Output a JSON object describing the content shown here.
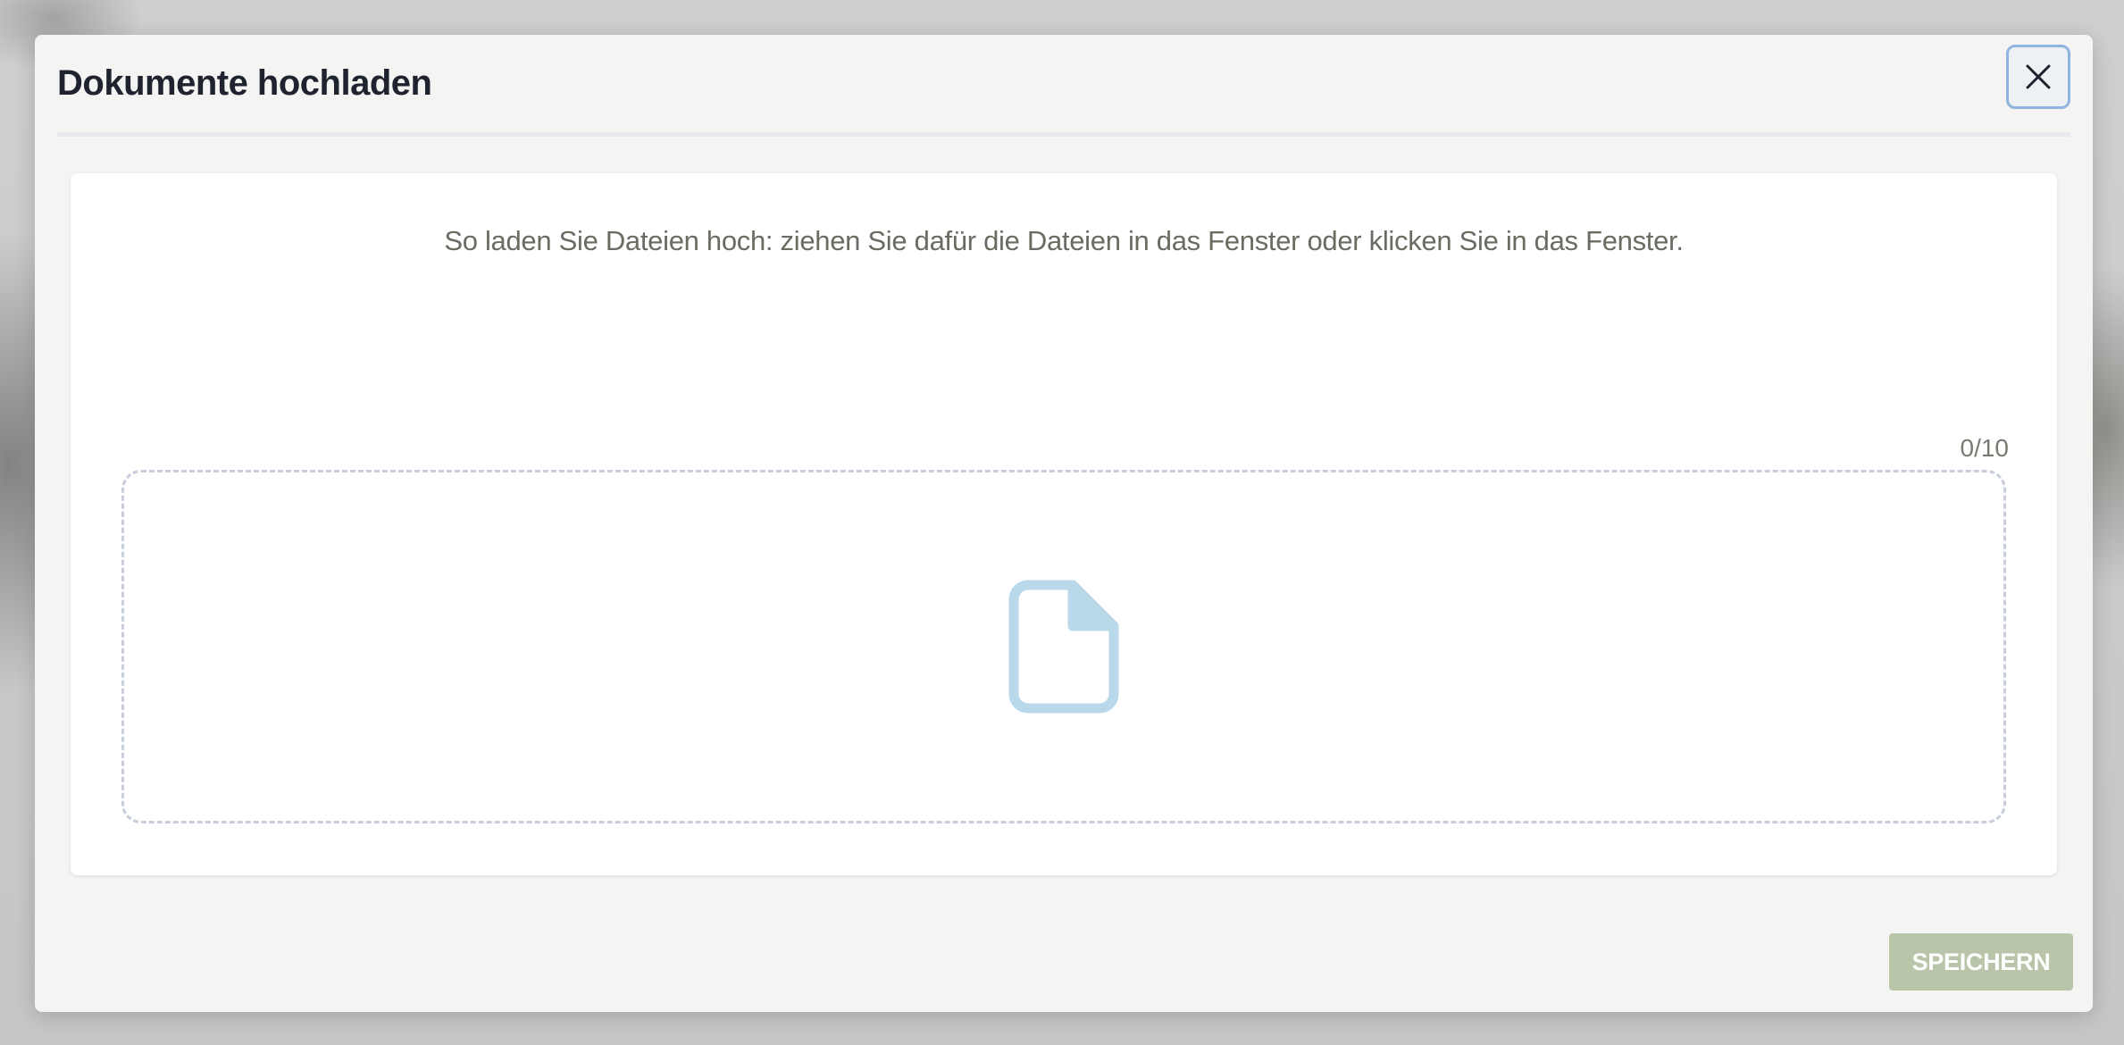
{
  "modal": {
    "title": "Dokumente hochladen",
    "close_icon": "close-icon"
  },
  "upload": {
    "instructions": "So laden Sie Dateien hoch: ziehen Sie dafür die Dateien in das Fenster oder klicken Sie in das Fenster.",
    "file_count": "0/10",
    "file_icon": "file-icon",
    "icon_color": "#b9d8ea"
  },
  "footer": {
    "save_label": "SPEICHERN",
    "save_color": "#b9c5a8"
  }
}
